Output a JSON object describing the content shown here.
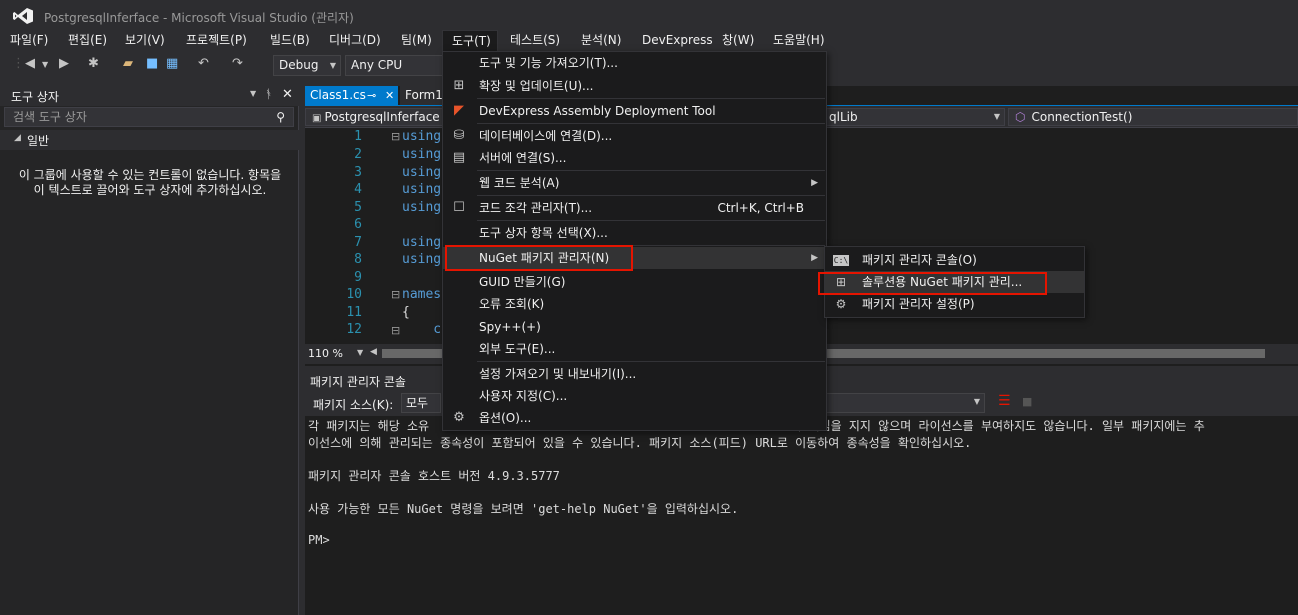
{
  "window": {
    "title": "PostgresqlInferface - Microsoft Visual Studio  (관리자)"
  },
  "menubar": [
    {
      "label": "파일(F)"
    },
    {
      "label": "편집(E)"
    },
    {
      "label": "보기(V)"
    },
    {
      "label": "프로젝트(P)"
    },
    {
      "label": "빌드(B)"
    },
    {
      "label": "디버그(D)"
    },
    {
      "label": "팀(M)"
    },
    {
      "label": "도구(T)"
    },
    {
      "label": "테스트(S)"
    },
    {
      "label": "분석(N)"
    },
    {
      "label": "DevExpress"
    },
    {
      "label": "창(W)"
    },
    {
      "label": "도움말(H)"
    }
  ],
  "toolbar": {
    "config": "Debug",
    "platform": "Any CPU"
  },
  "toolbox": {
    "title": "도구 상자",
    "search_placeholder": "검색 도구 상자",
    "group": "일반",
    "empty_message": "이 그룹에 사용할 수 있는 컨트롤이 없습니다. 항목을 이 텍스트로 끌어와 도구 상자에 추가하십시오."
  },
  "editor": {
    "tabs": [
      {
        "label": "Class1.cs"
      },
      {
        "label": "Form1."
      }
    ],
    "nav_project": "PostgresqlInferface",
    "nav_class": "qlLib",
    "nav_member": "ConnectionTest()",
    "line_numbers": [
      "1",
      "2",
      "3",
      "4",
      "5",
      "6",
      "7",
      "8",
      "9",
      "10",
      "11",
      "12"
    ],
    "code_lines": [
      "using",
      "using",
      "using",
      "using",
      "using",
      "",
      "using",
      "using",
      "",
      "namesp",
      "{",
      "    c"
    ],
    "zoom": "110 %"
  },
  "package_manager": {
    "title": "패키지 관리자 콘솔",
    "source_label": "패키지 소스(K):",
    "source_value": "모두",
    "lines": [
      "각 패키지는 해당 소유                                                  해 책임을 지지 않으며 라이선스를 부여하지도 않습니다. 일부 패키지에는 추",
      "이선스에 의해 관리되는 종속성이 포함되어 있을 수 있습니다. 패키지 소스(피드) URL로 이동하여 종속성을 확인하십시오.",
      "",
      "패키지 관리자 콘솔 호스트 버전 4.9.3.5777",
      "",
      "사용 가능한 모든 NuGet 명령을 보려면 'get-help NuGet'을 입력하십시오.",
      "",
      "PM>"
    ]
  },
  "tools_menu": [
    {
      "label": "도구 및 기능 가져오기(T)...",
      "icon": "none"
    },
    {
      "label": "확장 및 업데이트(U)...",
      "icon": "extensions-icon"
    },
    {
      "label": "DevExpress Assembly Deployment Tool",
      "icon": "devexpress-icon"
    },
    {
      "label": "데이터베이스에 연결(D)...",
      "icon": "database-connect-icon"
    },
    {
      "label": "서버에 연결(S)...",
      "icon": "server-connect-icon"
    },
    {
      "label": "웹 코드 분석(A)",
      "icon": "none"
    },
    {
      "label": "코드 조각 관리자(T)...",
      "icon": "snippet-icon",
      "shortcut": "Ctrl+K, Ctrl+B"
    },
    {
      "label": "도구 상자 항목 선택(X)...",
      "icon": "none"
    },
    {
      "label": "NuGet 패키지 관리자(N)",
      "icon": "none"
    },
    {
      "label": "GUID 만들기(G)",
      "icon": "none"
    },
    {
      "label": "오류 조회(K)",
      "icon": "none"
    },
    {
      "label": "Spy++(+)",
      "icon": "none"
    },
    {
      "label": "외부 도구(E)...",
      "icon": "none"
    },
    {
      "label": "설정 가져오기 및 내보내기(I)...",
      "icon": "none"
    },
    {
      "label": "사용자 지정(C)...",
      "icon": "none"
    },
    {
      "label": "옵션(O)...",
      "icon": "gear-icon"
    }
  ],
  "nuget_menu": [
    {
      "label": "패키지 관리자 콘솔(O)",
      "icon": "console-icon"
    },
    {
      "label": "솔루션용 NuGet 패키지 관리...",
      "icon": "package-icon"
    },
    {
      "label": "패키지 관리자 설정(P)",
      "icon": "gear-icon"
    }
  ],
  "colors": {
    "accent": "#007acc",
    "highlight_box": "#e51400",
    "background": "#2d2d30",
    "menu_bg": "#1b1b1c"
  }
}
